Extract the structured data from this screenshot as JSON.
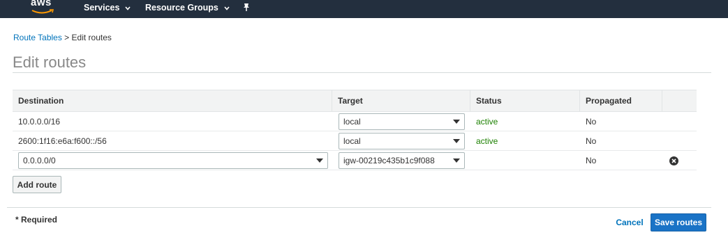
{
  "topnav": {
    "logo_text": "aws",
    "services_label": "Services",
    "resource_groups_label": "Resource Groups",
    "pin_icon": "pin-icon",
    "bg_color": "#232f3e"
  },
  "breadcrumb": {
    "parent": "Route Tables",
    "separator": ">",
    "current": "Edit routes"
  },
  "page_title": "Edit routes",
  "table": {
    "headers": {
      "destination": "Destination",
      "target": "Target",
      "status": "Status",
      "propagated": "Propagated"
    },
    "rows": [
      {
        "destination": "10.0.0.0/16",
        "target": "local",
        "status": "active",
        "propagated": "No"
      },
      {
        "destination": "2600:1f16:e6a:f600::/56",
        "target": "local",
        "status": "active",
        "propagated": "No"
      },
      {
        "destination": "0.0.0.0/0",
        "target": "igw-00219c435b1c9f088",
        "status": "",
        "propagated": "No"
      }
    ],
    "status_active_color": "#1d8102"
  },
  "buttons": {
    "add_route": "Add route",
    "cancel": "Cancel",
    "save_routes": "Save routes",
    "primary_color": "#1a73c6",
    "link_color": "#0073bb"
  },
  "footer": {
    "required_note": "* Required"
  }
}
